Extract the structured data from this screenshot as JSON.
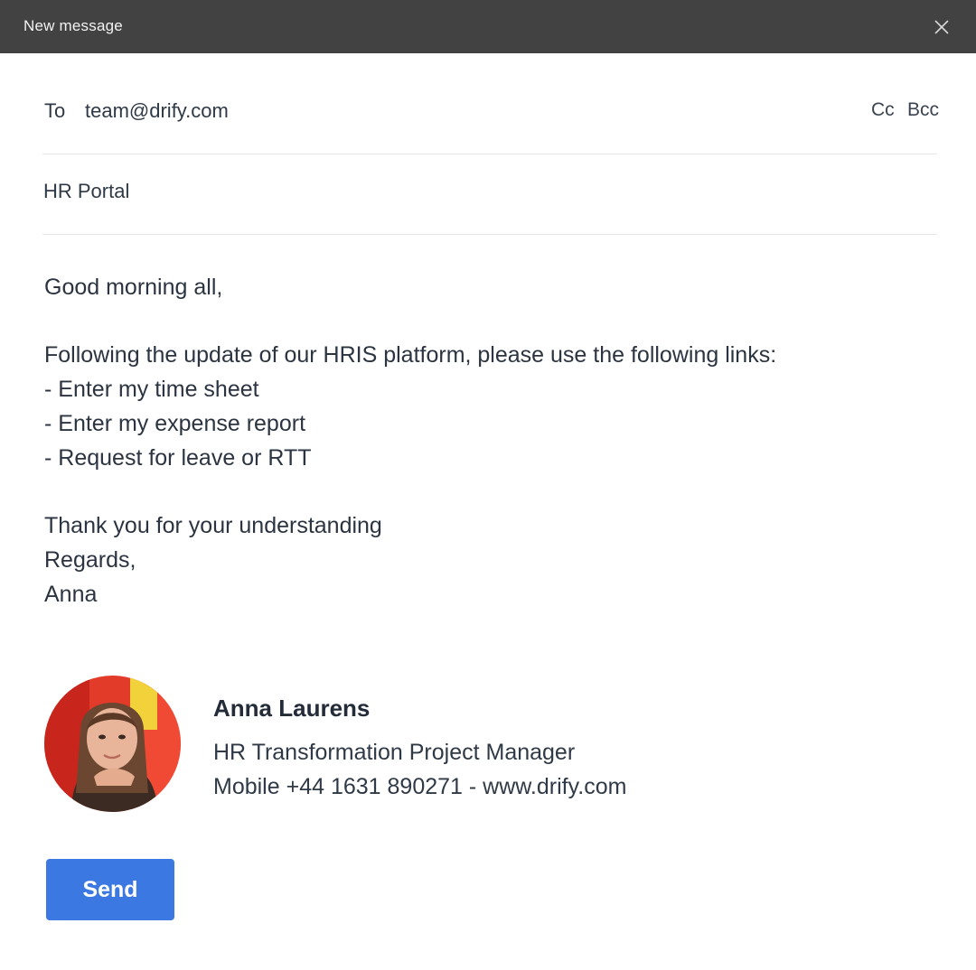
{
  "window": {
    "title": "New message",
    "close_icon": "close-icon"
  },
  "compose": {
    "to_label": "To",
    "to_value": "team@drify.com",
    "cc_label": "Cc",
    "bcc_label": "Bcc",
    "subject": "HR Portal"
  },
  "body": {
    "greeting": "Good morning all,",
    "intro": "Following the update of our HRIS platform, please use the following links:",
    "links": [
      "- Enter my time sheet",
      "- Enter my expense report",
      "- Request for leave or RTT"
    ],
    "closing": "Thank you for your understanding",
    "regards": "Regards,",
    "sender_first": "Anna"
  },
  "signature": {
    "name": "Anna Laurens",
    "title": "HR Transformation Project Manager",
    "contact": "Mobile +44 1631 890271 - www.drify.com"
  },
  "actions": {
    "send_label": "Send"
  },
  "colors": {
    "titlebar": "#424242",
    "send_button": "#3b78e2",
    "text": "#2b3440"
  }
}
